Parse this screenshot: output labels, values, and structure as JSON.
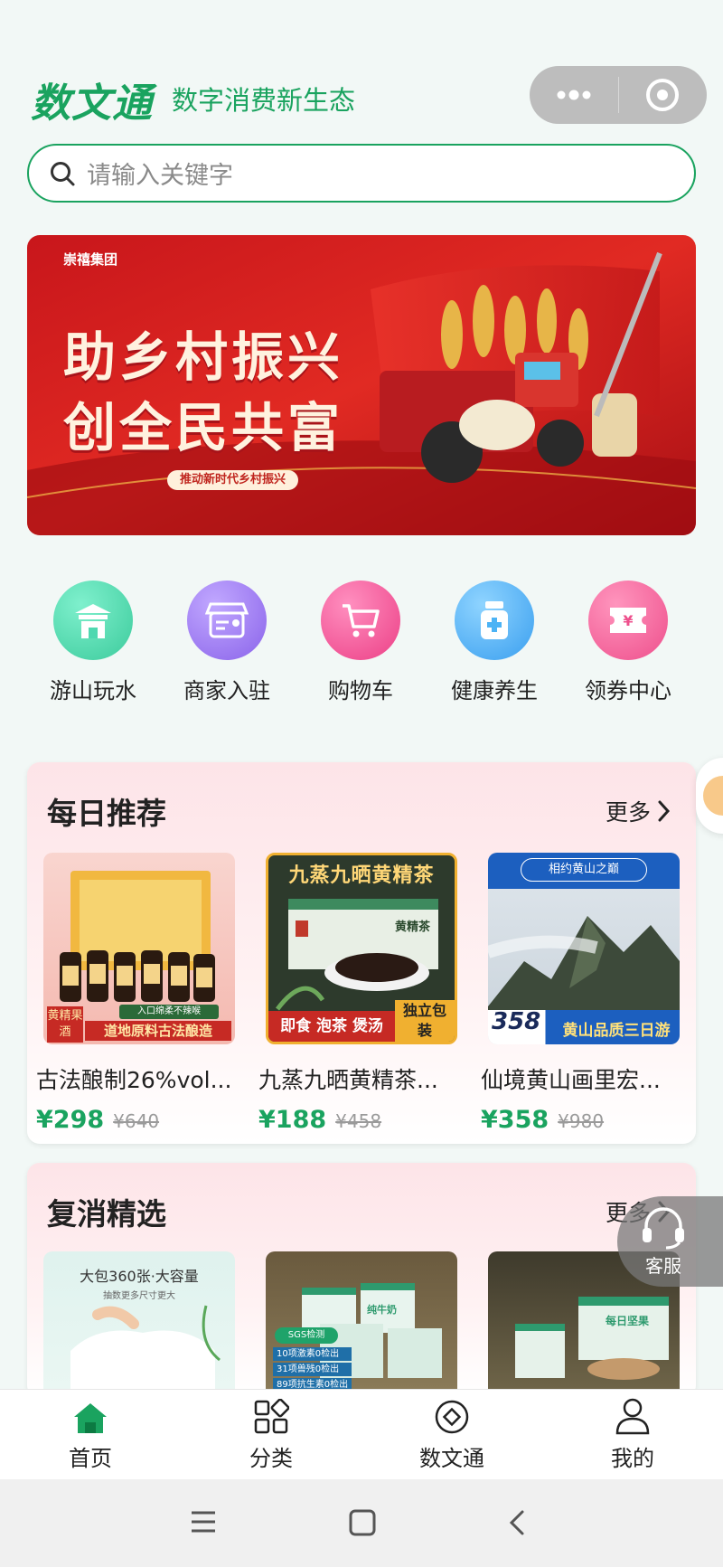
{
  "header": {
    "brand": "数文通",
    "slogan": "数字消费新生态"
  },
  "search": {
    "placeholder": "请输入关键字"
  },
  "banner": {
    "company": "崇禧集团",
    "headline_1": "助乡村振兴",
    "headline_2": "创全民共富",
    "tagline": "推动新时代乡村振兴"
  },
  "quick_nav": [
    {
      "label": "游山玩水",
      "icon": "temple-icon",
      "color": "#4fd8b0"
    },
    {
      "label": "商家入驻",
      "icon": "store-icon",
      "color": "#9c7ef0"
    },
    {
      "label": "购物车",
      "icon": "cart-icon",
      "color": "#f45d9c"
    },
    {
      "label": "健康养生",
      "icon": "medicine-bottle-icon",
      "color": "#4cb3f5"
    },
    {
      "label": "领券中心",
      "icon": "coupon-icon",
      "color": "#f5669e"
    }
  ],
  "daily": {
    "title": "每日推荐",
    "more": "更多",
    "products": [
      {
        "name": "古法酿制26%vol...",
        "price": "¥298",
        "orig": "¥640",
        "badge": "黄精果酒",
        "caption": "道地原料古法酿造",
        "stamp": "入口绵柔不辣喉"
      },
      {
        "name": "九蒸九晒黄精茶...",
        "price": "¥188",
        "orig": "¥458",
        "top_text": "九蒸九晒黄精茶",
        "caption": "即食 泡茶 煲汤",
        "side": "独立包装",
        "box_text": "黄精茶"
      },
      {
        "name": "仙境黄山画里宏...",
        "price": "¥358",
        "orig": "¥980",
        "top_text": "相约黄山之巅",
        "num": "358",
        "caption": "黄山品质三日游"
      }
    ]
  },
  "repurchase": {
    "title": "复消精选",
    "more": "更多",
    "products": [
      {
        "top_text": "大包360张·大容量",
        "sub": "抽数更多尺寸更大"
      },
      {
        "tag": "SGS检测",
        "lines": [
          "10项激素0检出",
          "31项兽残0检出",
          "89项抗生素0检出"
        ],
        "box_text": "纯牛奶"
      },
      {
        "box_text": "每日坚果"
      }
    ]
  },
  "floating": {
    "service_label": "客服"
  },
  "tabbar": [
    {
      "label": "首页",
      "icon": "home-icon",
      "active": true
    },
    {
      "label": "分类",
      "icon": "category-icon",
      "active": false
    },
    {
      "label": "数文通",
      "icon": "coin-icon",
      "active": false
    },
    {
      "label": "我的",
      "icon": "user-icon",
      "active": false
    }
  ],
  "colors": {
    "brand": "#1aa35f",
    "price": "#1aa35f"
  }
}
